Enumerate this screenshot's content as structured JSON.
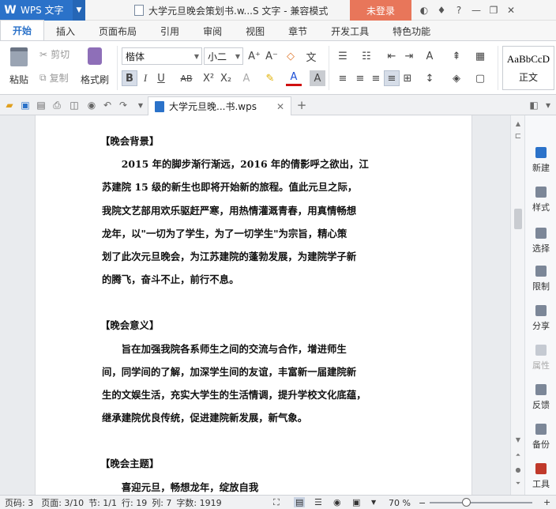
{
  "titlebar": {
    "app_name": "WPS 文字",
    "doc_title": "大学元旦晚会策划书.w...S 文字 - 兼容模式",
    "login": "未登录",
    "icons": [
      "skin-icon",
      "shirt-icon",
      "help-icon",
      "minimize-icon",
      "restore-icon",
      "close-icon"
    ]
  },
  "tabs": [
    "开始",
    "插入",
    "页面布局",
    "引用",
    "审阅",
    "视图",
    "章节",
    "开发工具",
    "特色功能"
  ],
  "active_tab": "开始",
  "ribbon": {
    "paste": "粘贴",
    "cut": "剪切",
    "copy": "复制",
    "format_painter": "格式刷",
    "font_name": "楷体",
    "font_size": "小二",
    "style_sample": "AaBbCcD",
    "style_name": "正文"
  },
  "doc_tab": {
    "name": "大学元旦晚...书.wps"
  },
  "document": {
    "lines": [
      {
        "type": "head",
        "text": "【晚会背景】"
      },
      {
        "type": "ind",
        "text": "2015 年的脚步渐行渐远，2016 年的倩影呼之欲出，江"
      },
      {
        "type": "plain",
        "text": "苏建院 15 级的新生也即将开始新的旅程。值此元旦之际，"
      },
      {
        "type": "plain",
        "text": "我院文艺部用欢乐驱赶严寒，用热情灌溉青春，用真情畅想"
      },
      {
        "type": "plain",
        "text": "龙年，以\"一切为了学生，为了一切学生\"为宗旨，精心策"
      },
      {
        "type": "plain",
        "text": "划了此次元旦晚会，为江苏建院的蓬勃发展，为建院学子新"
      },
      {
        "type": "plain",
        "text": "的腾飞，奋斗不止，前行不息。"
      },
      {
        "type": "gap",
        "text": ""
      },
      {
        "type": "head",
        "text": "【晚会意义】"
      },
      {
        "type": "ind",
        "text": "旨在加强我院各系师生之间的交流与合作，增进师生"
      },
      {
        "type": "plain",
        "text": "间，同学间的了解，加深学生间的友谊，丰富新一届建院新"
      },
      {
        "type": "plain",
        "text": "生的文娱生活，充实大学生的生活情调，提升学校文化底蕴，"
      },
      {
        "type": "plain",
        "text": "继承建院优良传统，促进建院新发展，新气象。"
      },
      {
        "type": "gap",
        "text": ""
      },
      {
        "type": "head",
        "text": "【晚会主题】"
      },
      {
        "type": "ind",
        "text": "喜迎元旦，畅想龙年，绽放自我"
      }
    ]
  },
  "task_pane": [
    "新建",
    "样式",
    "选择",
    "限制",
    "分享",
    "属性",
    "反馈",
    "备份",
    "工具"
  ],
  "status": {
    "page_code": "页码: 3",
    "page": "页面: 3/10",
    "section": "节: 1/1",
    "row": "行: 19",
    "col": "列: 7",
    "words": "字数: 1919",
    "zoom": "70 %",
    "zoom_value": 0.35
  }
}
